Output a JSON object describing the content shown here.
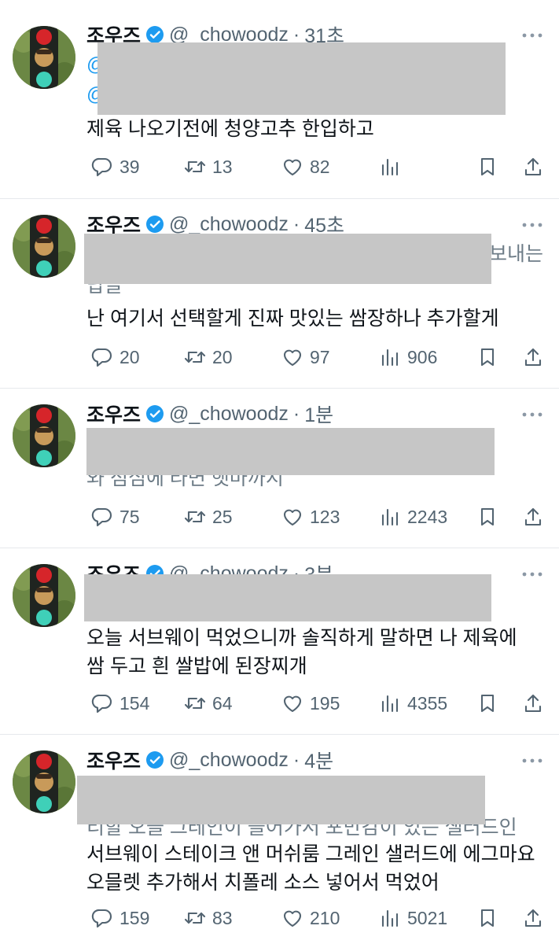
{
  "tweets": [
    {
      "name": "조우즈",
      "handle": "@_chowoodz",
      "time": "31초",
      "ghost_lines": [],
      "lines": [
        "제육 나오기전에 청양고추 한입하고"
      ],
      "replies": "39",
      "retweets": "13",
      "likes": "82",
      "views": ""
    },
    {
      "name": "조우즈",
      "handle": "@_chowoodz",
      "time": "45초",
      "ghost_lines": [
        "보내는",
        "답글"
      ],
      "lines": [
        "난 여기서 선택할게 진짜 맛있는 쌈장하나 추가할게"
      ],
      "replies": "20",
      "retweets": "20",
      "likes": "97",
      "views": "906"
    },
    {
      "name": "조우즈",
      "handle": "@_chowoodz",
      "time": "1분",
      "ghost_lines": [
        "와 점심에 라면 햇마까지"
      ],
      "lines": [],
      "replies": "75",
      "retweets": "25",
      "likes": "123",
      "views": "2243"
    },
    {
      "name": "조우즈",
      "handle": "@_chowoodz",
      "time": "3분",
      "ghost_lines": [],
      "lines": [
        "오늘 서브웨이 먹었으니까 솔직하게 말하면 나 제육에",
        "쌈 두고 흰 쌀밥에 된장찌개"
      ],
      "replies": "154",
      "retweets": "64",
      "likes": "195",
      "views": "4355"
    },
    {
      "name": "조우즈",
      "handle": "@_chowoodz",
      "time": "4분",
      "ghost_lines": [
        "티할 오늘 그레인이 들어가서 포만감이 있는 샐러드인"
      ],
      "lines": [
        "서브웨이 스테이크 앤 머쉬룸 그레인 샐러드에 에그마요",
        "오믈렛 추가해서 치폴레 소스 넣어서 먹었어"
      ],
      "replies": "159",
      "retweets": "83",
      "likes": "210",
      "views": "5021"
    }
  ],
  "icons": {
    "verified": "verified-badge-icon",
    "reply": "reply-icon",
    "retweet": "retweet-icon",
    "like": "heart-icon",
    "views": "views-icon",
    "bookmark": "bookmark-icon",
    "share": "share-icon",
    "more": "more-icon"
  },
  "colors": {
    "verified": "#1d9bf0",
    "muted": "#536471",
    "text": "#0f1419",
    "redaction": "#c6c6c6"
  }
}
